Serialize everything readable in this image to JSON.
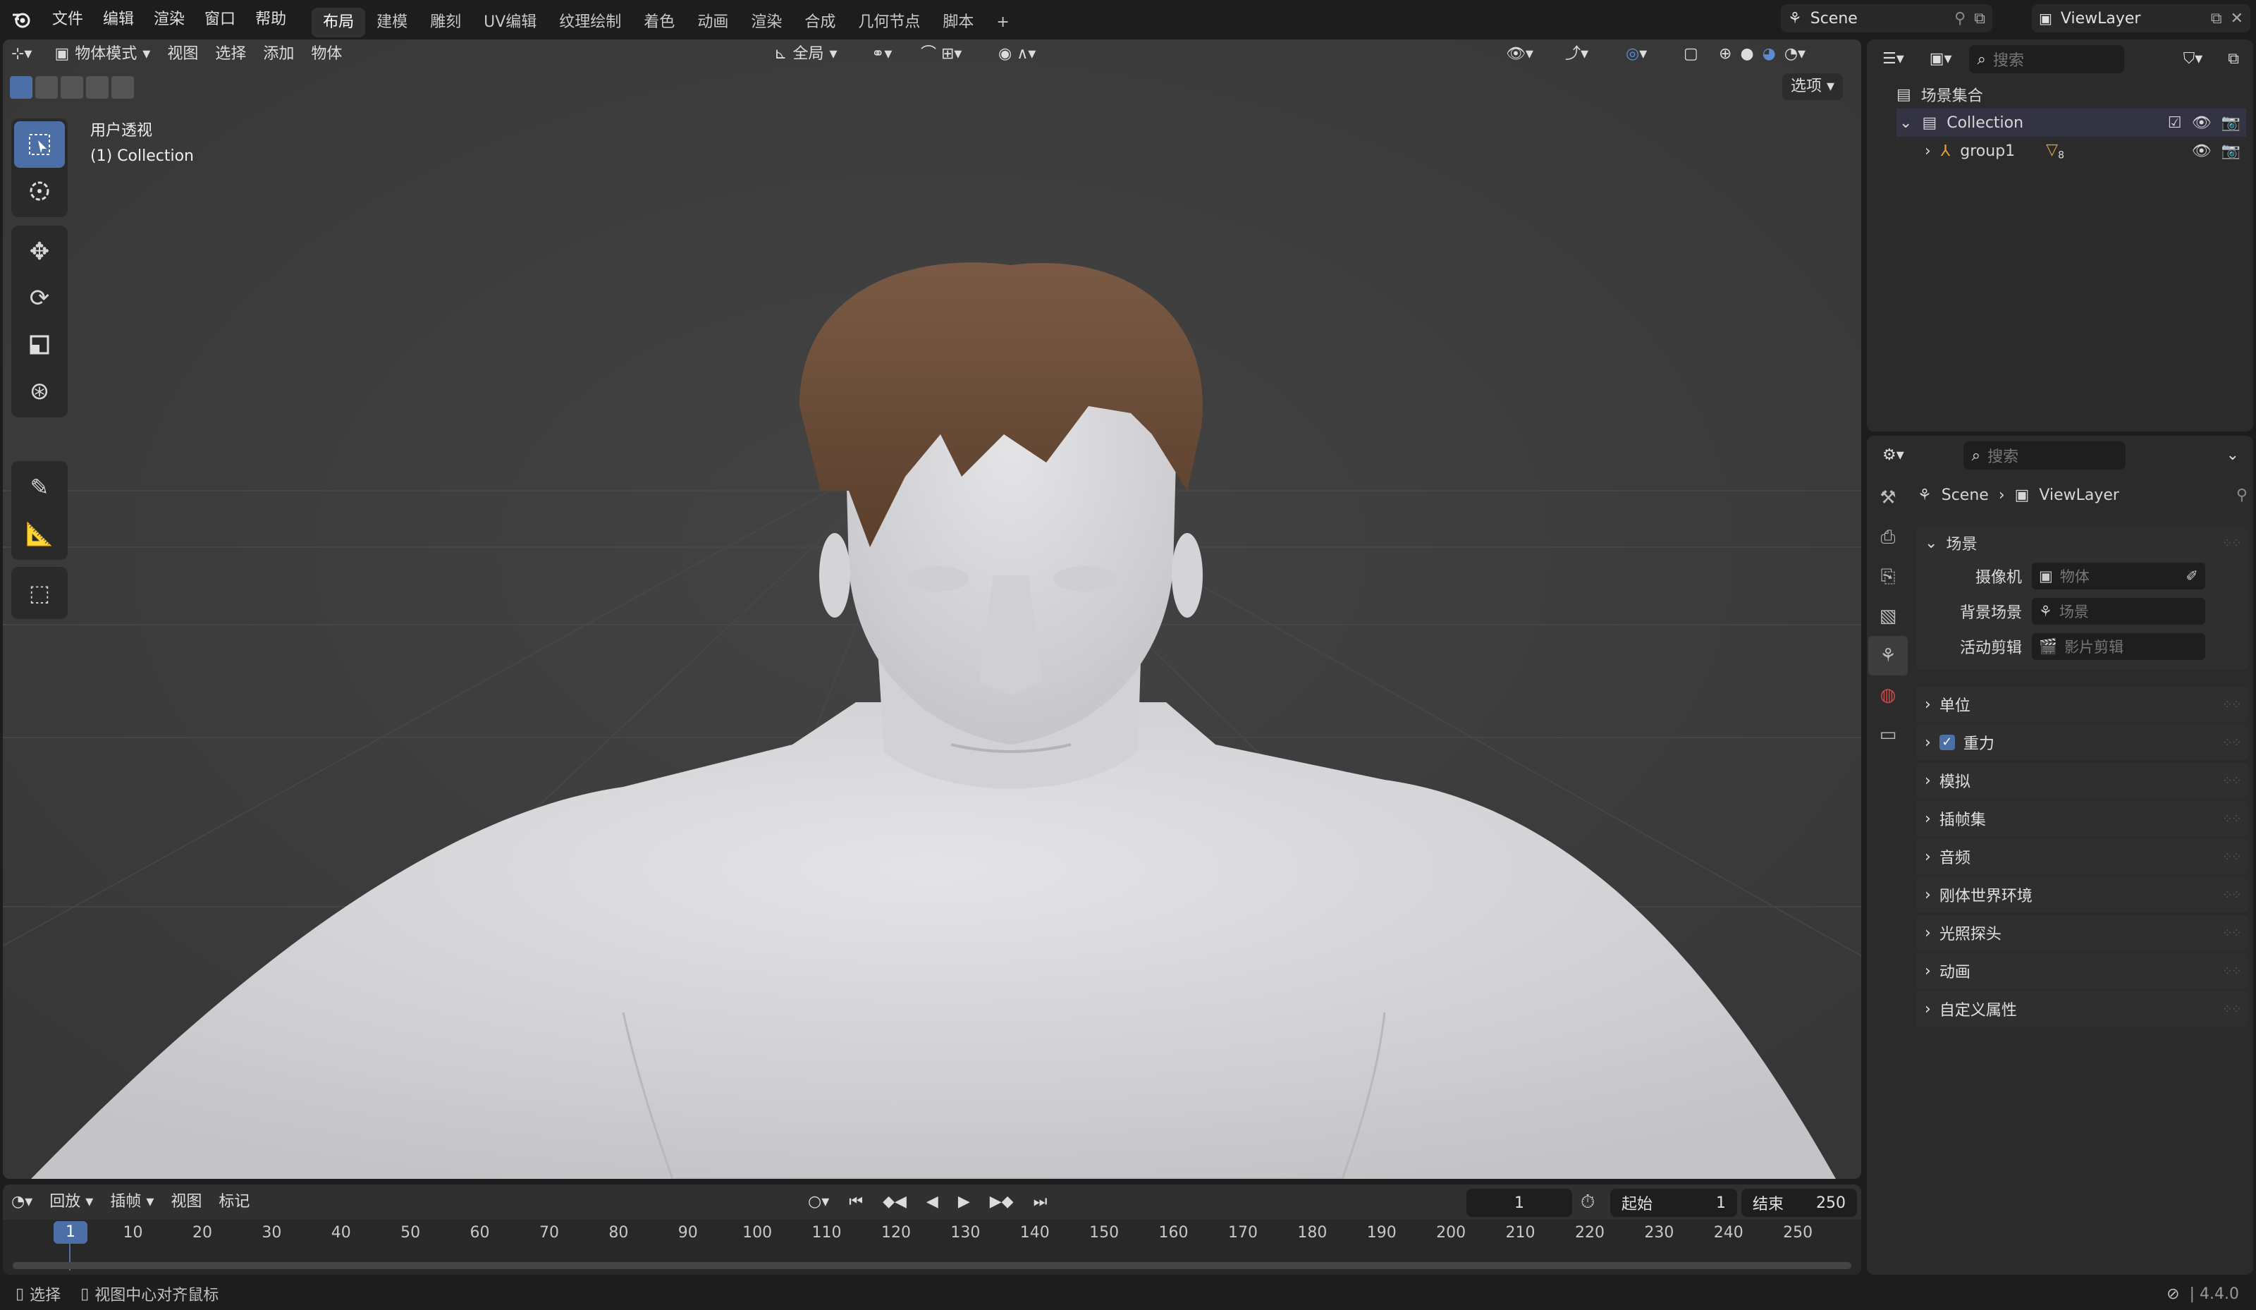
{
  "top_menu": [
    "文件",
    "编辑",
    "渲染",
    "窗口",
    "帮助"
  ],
  "workspaces": [
    "布局",
    "建模",
    "雕刻",
    "UV编辑",
    "纹理绘制",
    "着色",
    "动画",
    "渲染",
    "合成",
    "几何节点",
    "脚本"
  ],
  "active_workspace": "布局",
  "add_workspace": "+",
  "scene_name": "Scene",
  "view_layer_name": "ViewLayer",
  "viewport": {
    "mode": "物体模式",
    "menus": [
      "视图",
      "选择",
      "添加",
      "物体"
    ],
    "transform_orientation": "全局",
    "options_label": "选项",
    "overlay_title": "用户透视",
    "overlay_collection": "(1) Collection"
  },
  "timeline": {
    "menus": [
      "回放",
      "插帧",
      "视图",
      "标记"
    ],
    "current_frame": "1",
    "start_label": "起始",
    "start_value": "1",
    "end_label": "结束",
    "end_value": "250",
    "playhead": "1",
    "frame_ticks": [
      "10",
      "20",
      "30",
      "40",
      "50",
      "60",
      "70",
      "80",
      "90",
      "100",
      "110",
      "120",
      "130",
      "140",
      "150",
      "160",
      "170",
      "180",
      "190",
      "200",
      "210",
      "220",
      "230",
      "240",
      "250"
    ]
  },
  "status_bar": {
    "select": "选择",
    "center_view": "视图中心对齐鼠标",
    "version": "4.4.0"
  },
  "outliner": {
    "search_placeholder": "搜索",
    "root": "场景集合",
    "collection": "Collection",
    "object": "group1",
    "object_badge": "8"
  },
  "properties": {
    "search_placeholder": "搜索",
    "breadcrumb_scene": "Scene",
    "breadcrumb_layer": "ViewLayer",
    "scene_panel": "场景",
    "camera_label": "摄像机",
    "camera_placeholder": "物体",
    "bg_scene_label": "背景场景",
    "bg_scene_placeholder": "场景",
    "clip_label": "活动剪辑",
    "clip_placeholder": "影片剪辑",
    "sections": [
      "单位",
      "重力",
      "模拟",
      "插帧集",
      "音频",
      "刚体世界环境",
      "光照探头",
      "动画",
      "自定义属性"
    ]
  },
  "colors": {
    "accent": "#4b6fa6",
    "hair": "#6b4a33",
    "skin": "#d9d9dc"
  }
}
